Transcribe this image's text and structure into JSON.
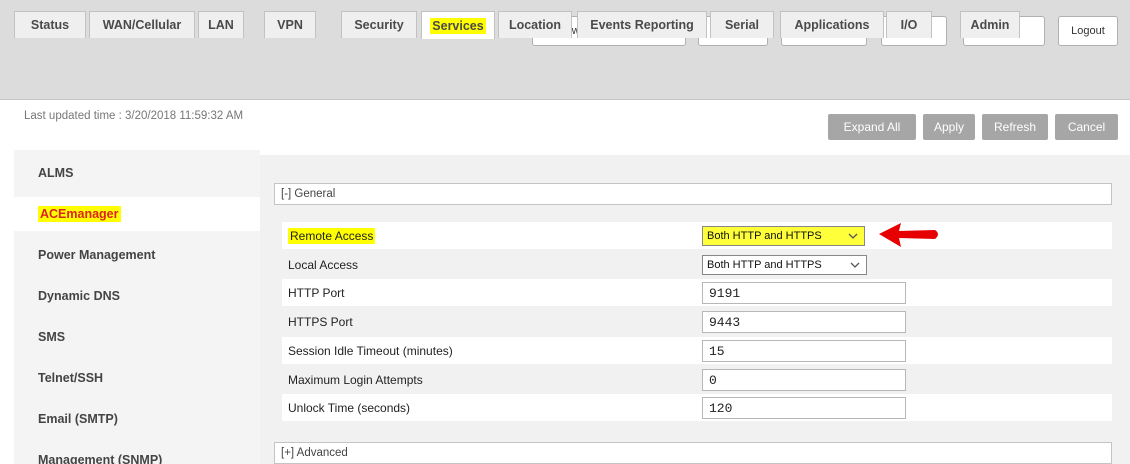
{
  "top_buttons": [
    "Software and Firmware",
    "Template",
    "Refresh All",
    "Reboot",
    "Help",
    "Logout"
  ],
  "tabs": [
    "Status",
    "WAN/Cellular",
    "LAN",
    "VPN",
    "Security",
    "Services",
    "Location",
    "Events Reporting",
    "Serial",
    "Applications",
    "I/O",
    "Admin"
  ],
  "active_tab": "Services",
  "last_updated": "Last updated time : 3/20/2018 11:59:32 AM",
  "actions": [
    "Expand All",
    "Apply",
    "Refresh",
    "Cancel"
  ],
  "sidebar": [
    "ALMS",
    "ACEmanager",
    "Power Management",
    "Dynamic DNS",
    "SMS",
    "Telnet/SSH",
    "Email (SMTP)",
    "Management (SNMP)"
  ],
  "active_sidebar": "ACEmanager",
  "general_header": "[-] General",
  "advanced_header": "[+] Advanced",
  "fields": {
    "remote_access": {
      "label": "Remote Access",
      "value": "Both HTTP and HTTPS"
    },
    "local_access": {
      "label": "Local Access",
      "value": "Both HTTP and HTTPS"
    },
    "http_port": {
      "label": "HTTP Port",
      "value": "9191"
    },
    "https_port": {
      "label": "HTTPS Port",
      "value": "9443"
    },
    "session_timeout": {
      "label": "Session Idle Timeout (minutes)",
      "value": "15"
    },
    "max_login": {
      "label": "Maximum Login Attempts",
      "value": "0"
    },
    "unlock_time": {
      "label": "Unlock Time (seconds)",
      "value": "120"
    }
  },
  "colors": {
    "highlight": "#ffff00",
    "annotation_arrow": "#e60000",
    "active_sidebar_text": "#dd2222",
    "action_button": "#a6a6a6"
  },
  "icons": [
    "chevron-down-icon",
    "red-arrow-annotation"
  ]
}
